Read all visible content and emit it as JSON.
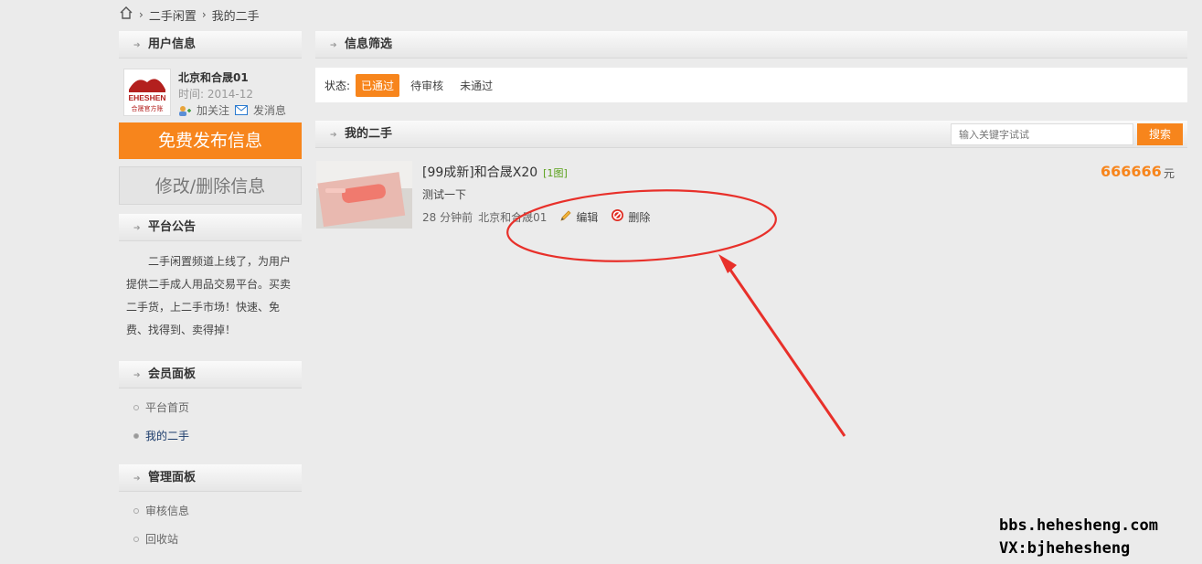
{
  "breadcrumb": {
    "home_icon": "home-icon",
    "items": [
      "二手闲置",
      "我的二手"
    ]
  },
  "sidebar": {
    "user_section_title": "用户信息",
    "user": {
      "avatar_text": "EHESHEN",
      "avatar_subtext": "合晟官方账",
      "name": "北京和合晟01",
      "time": "时间: 2014-12",
      "follow_label": "加关注",
      "message_label": "发消息"
    },
    "publish_button": "免费发布信息",
    "manage_button": "修改/删除信息",
    "notice_title": "平台公告",
    "notice_text": "二手闲置频道上线了，为用户提供二手成人用品交易平台。买卖二手货，上二手市场！快速、免费、找得到、卖得掉！",
    "member_panel_title": "会员面板",
    "member_items": [
      "平台首页",
      "我的二手"
    ],
    "admin_panel_title": "管理面板",
    "admin_items": [
      "审核信息",
      "回收站"
    ]
  },
  "filter": {
    "title": "信息筛选",
    "status_label": "状态:",
    "options": [
      "已通过",
      "待审核",
      "未通过"
    ],
    "active": "已通过"
  },
  "my_items": {
    "title": "我的二手",
    "search_placeholder": "输入关键字试试",
    "search_button": "搜索",
    "items": [
      {
        "title": "[99成新]和合晟X20",
        "pics": "[1图]",
        "desc": "测试一下",
        "time": "28 分钟前",
        "user": "北京和合晟01",
        "edit": "编辑",
        "delete": "删除",
        "price": "666666",
        "unit": "元"
      }
    ]
  },
  "watermark": {
    "line1": "bbs.hehesheng.com",
    "line2": "VX:bjhehesheng"
  },
  "colors": {
    "accent": "#f7851c",
    "annotation": "#e8302a"
  }
}
